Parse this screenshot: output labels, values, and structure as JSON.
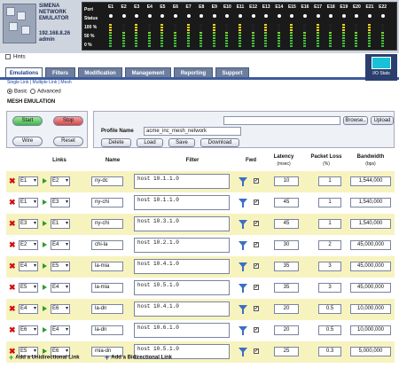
{
  "brand": {
    "line1": "SIMENA",
    "line2": "NETWORK",
    "line3": "EMULATOR",
    "ip": "192.168.8.26",
    "user": "admin"
  },
  "ports": {
    "row_labels": [
      "Port",
      "Status",
      "100 %",
      "50 %",
      "0 %"
    ],
    "names": [
      "E1",
      "E2",
      "E3",
      "E4",
      "E5",
      "E6",
      "E7",
      "E8",
      "E9",
      "E10",
      "E11",
      "E12",
      "E13",
      "E14",
      "E15",
      "E16",
      "E17",
      "E18",
      "E19",
      "E20",
      "E21",
      "E22"
    ]
  },
  "hints": "Hints",
  "tabs": [
    "Emulations",
    "Filters",
    "Modification",
    "Management",
    "Reporting",
    "Support"
  ],
  "io_stats": "I/O Stats",
  "sublinks": [
    "Single Link",
    "Multiple Link",
    "Mesh"
  ],
  "mode": {
    "basic": "Basic",
    "advanced": "Advanced"
  },
  "section_title": "MESH EMULATION",
  "controls": {
    "start": "Start",
    "stop": "Stop",
    "wire": "Wire",
    "reset": "Reset"
  },
  "profile": {
    "browse": "Browse..",
    "upload": "Upload",
    "label": "Profile Name",
    "value": "acme_inc_mesh_network",
    "delete": "Delete",
    "load": "Load",
    "save": "Save",
    "download": "Download"
  },
  "columns": {
    "links": "Links",
    "name": "Name",
    "filter": "Filter",
    "fwd": "Fwd",
    "latency": "Latency",
    "latency_unit": "(msec)",
    "loss": "Packet Loss",
    "loss_unit": "(%)",
    "bandwidth": "Bandwidth",
    "bandwidth_unit": "(bps)"
  },
  "rows": [
    {
      "from": "E1",
      "to": "E2",
      "name": "ny-dc",
      "filter": "host 10.1.1.0",
      "latency": "10",
      "loss": "1",
      "bandwidth": "1,544,000"
    },
    {
      "from": "E1",
      "to": "E3",
      "name": "ny-chi",
      "filter": "host 10.1.1.0",
      "latency": "45",
      "loss": "1",
      "bandwidth": "1,540,000"
    },
    {
      "from": "E3",
      "to": "E1",
      "name": "ny-chi",
      "filter": "host 10.3.1.0",
      "latency": "45",
      "loss": "1",
      "bandwidth": "1,540,000"
    },
    {
      "from": "E2",
      "to": "E4",
      "name": "chi-la",
      "filter": "host 10.2.1.0",
      "latency": "30",
      "loss": "2",
      "bandwidth": "45,000,000"
    },
    {
      "from": "E4",
      "to": "E5",
      "name": "la-mia",
      "filter": "host 10.4.1.0",
      "latency": "35",
      "loss": "3",
      "bandwidth": "45,000,000"
    },
    {
      "from": "E5",
      "to": "E4",
      "name": "la-mia",
      "filter": "host 10.5.1.0",
      "latency": "35",
      "loss": "3",
      "bandwidth": "45,000,000"
    },
    {
      "from": "E4",
      "to": "E6",
      "name": "la-dn",
      "filter": "host 10.4.1.0",
      "latency": "20",
      "loss": "0.5",
      "bandwidth": "10,000,000"
    },
    {
      "from": "E6",
      "to": "E4",
      "name": "la-dn",
      "filter": "host 10.6.1.0",
      "latency": "20",
      "loss": "0.5",
      "bandwidth": "10,000,000"
    },
    {
      "from": "E5",
      "to": "E6",
      "name": "mia-dn",
      "filter": "host 10.5.1.0",
      "latency": "25",
      "loss": "0.3",
      "bandwidth": "5,000,000"
    }
  ],
  "footer": {
    "add_uni": "Add a Unidirectional Link",
    "add_bi": "Add a Bidirectional Link"
  }
}
